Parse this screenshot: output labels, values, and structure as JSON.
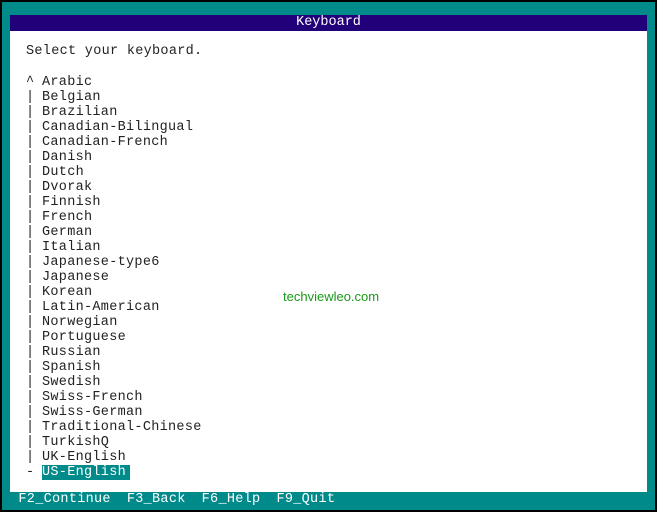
{
  "title": "Keyboard",
  "prompt": "Select your keyboard.",
  "layouts": [
    {
      "mark": "^",
      "label": "Arabic"
    },
    {
      "mark": "|",
      "label": "Belgian"
    },
    {
      "mark": "|",
      "label": "Brazilian"
    },
    {
      "mark": "|",
      "label": "Canadian-Bilingual"
    },
    {
      "mark": "|",
      "label": "Canadian-French"
    },
    {
      "mark": "|",
      "label": "Danish"
    },
    {
      "mark": "|",
      "label": "Dutch"
    },
    {
      "mark": "|",
      "label": "Dvorak"
    },
    {
      "mark": "|",
      "label": "Finnish"
    },
    {
      "mark": "|",
      "label": "French"
    },
    {
      "mark": "|",
      "label": "German"
    },
    {
      "mark": "|",
      "label": "Italian"
    },
    {
      "mark": "|",
      "label": "Japanese-type6"
    },
    {
      "mark": "|",
      "label": "Japanese"
    },
    {
      "mark": "|",
      "label": "Korean"
    },
    {
      "mark": "|",
      "label": "Latin-American"
    },
    {
      "mark": "|",
      "label": "Norwegian"
    },
    {
      "mark": "|",
      "label": "Portuguese"
    },
    {
      "mark": "|",
      "label": "Russian"
    },
    {
      "mark": "|",
      "label": "Spanish"
    },
    {
      "mark": "|",
      "label": "Swedish"
    },
    {
      "mark": "|",
      "label": "Swiss-French"
    },
    {
      "mark": "|",
      "label": "Swiss-German"
    },
    {
      "mark": "|",
      "label": "Traditional-Chinese"
    },
    {
      "mark": "|",
      "label": "TurkishQ"
    },
    {
      "mark": "|",
      "label": "UK-English"
    },
    {
      "mark": "-",
      "label": "US-English",
      "selected": true
    }
  ],
  "footer": [
    "F2_Continue",
    "F3_Back",
    "F6_Help",
    "F9_Quit"
  ],
  "watermark": "techviewleo.com",
  "colors": {
    "background": "#008a8a",
    "title_bar": "#22007a",
    "selection": "#008a8a"
  }
}
